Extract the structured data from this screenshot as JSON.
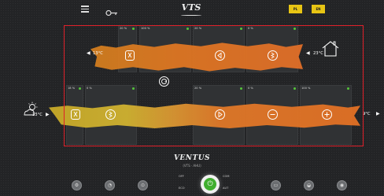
{
  "topbar": {
    "menu_icon": "hamburger-menu-icon",
    "key_icon": "key-icon",
    "logo": "VTS",
    "lang_buttons": [
      "PL",
      "EN"
    ]
  },
  "top_panels": [
    {
      "header": "20 %",
      "status": "green"
    },
    {
      "header": "100 %",
      "status": "green"
    },
    {
      "header": "20 %",
      "status": "green"
    },
    {
      "header": "0 %",
      "status": "green"
    }
  ],
  "bottom_panels": [
    {
      "header": "18 %",
      "status": "green"
    },
    {
      "header": "0 %",
      "status": "green"
    },
    {
      "header": "20 %",
      "status": "green"
    },
    {
      "header": "0 %",
      "status": "green"
    },
    {
      "header": "100 %",
      "status": "green"
    }
  ],
  "temps": {
    "exhaust_left": "13°C",
    "extract_right": "23°C",
    "outdoor": "13°C",
    "supply_right": "9°C"
  },
  "brand": {
    "name": "VENTUS",
    "subtitle": "(VTS · AHU)"
  },
  "modes": {
    "left_top": "OFF",
    "left_bottom": "ECO",
    "right_top": "COM",
    "right_bottom": "AUT"
  },
  "bottom_buttons": [
    "settings-icon",
    "alarm-icon",
    "clock-icon",
    "chart-icon",
    "graph-icon",
    "info-icon"
  ]
}
